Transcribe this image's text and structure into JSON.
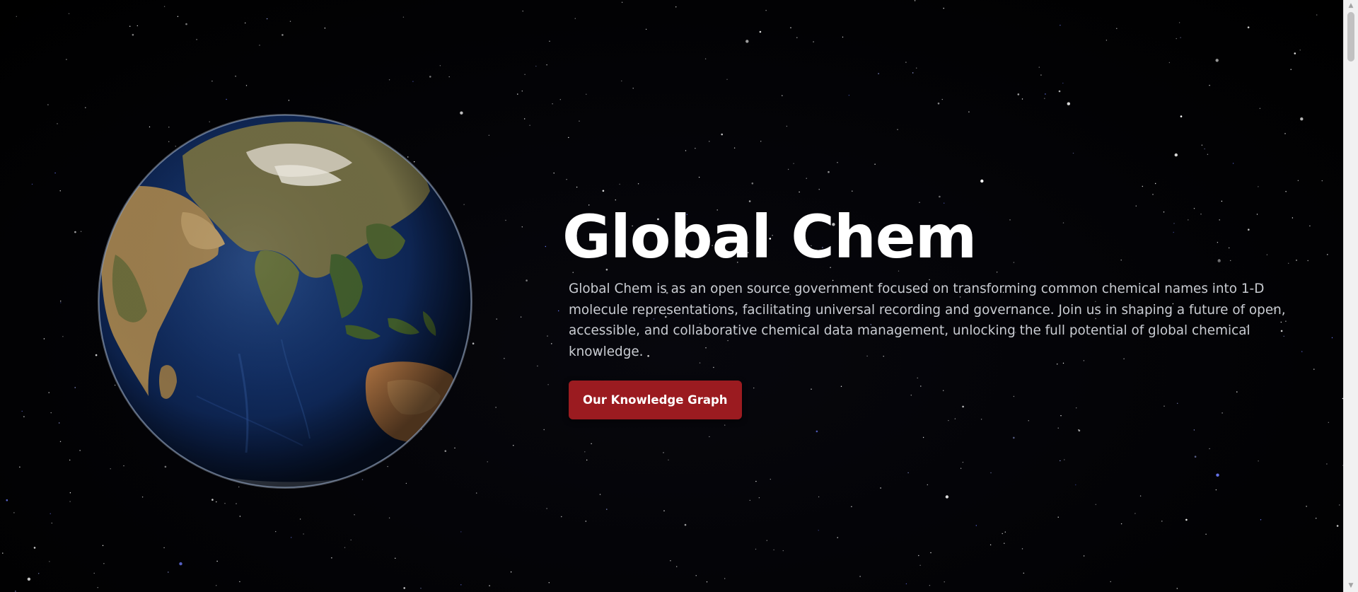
{
  "hero": {
    "title": "Global Chem",
    "description": "Global Chem is as an open source government focused on transforming common chemical names into 1-D molecule representations, facilitating universal recording and governance. Join us in shaping a future of open, accessible, and collaborative chemical data management, unlocking the full potential of global chemical knowledge.",
    "cta_label": "Our Knowledge Graph"
  },
  "background": {
    "image": "starfield-space",
    "globe": "earth-globe-indian-ocean-view"
  },
  "colors": {
    "background": "#030306",
    "title": "#ffffff",
    "description": "#c9ccd2",
    "button": "#9b1b20",
    "button_text": "#ffffff",
    "scrollbar_track": "#f1f1f1",
    "scrollbar_thumb": "#c1c1c1"
  },
  "scrollbar": {
    "up_icon": "scroll-up-arrow-icon",
    "down_icon": "scroll-down-arrow-icon"
  }
}
